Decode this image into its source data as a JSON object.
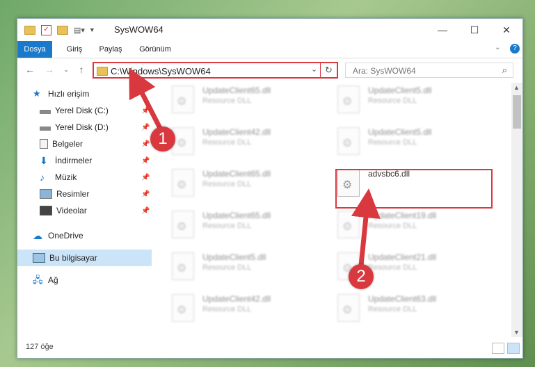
{
  "window": {
    "title": "SysWOW64"
  },
  "ribbon": {
    "tabs": [
      "Dosya",
      "Giriş",
      "Paylaş",
      "Görünüm"
    ]
  },
  "address": {
    "path": "C:\\Windows\\SysWOW64"
  },
  "search": {
    "placeholder": "Ara: SysWOW64"
  },
  "sidebar": {
    "items": [
      {
        "label": "Hızlı erişim"
      },
      {
        "label": "Yerel Disk (C:)"
      },
      {
        "label": "Yerel Disk (D:)"
      },
      {
        "label": "Belgeler"
      },
      {
        "label": "İndirmeler"
      },
      {
        "label": "Müzik"
      },
      {
        "label": "Resimler"
      },
      {
        "label": "Videolar"
      },
      {
        "label": "OneDrive"
      },
      {
        "label": "Bu bilgisayar"
      },
      {
        "label": "Ağ"
      }
    ]
  },
  "files": [
    {
      "name": "UpdateClient65.dll",
      "type": "Resource DLL"
    },
    {
      "name": "UpdateClient5.dll",
      "type": "Resource DLL"
    },
    {
      "name": "UpdateClient42.dll",
      "type": "Resource DLL"
    },
    {
      "name": "UpdateClient5.dll",
      "type": "Resource DLL"
    },
    {
      "name": "UpdateClient65.dll",
      "type": "Resource DLL"
    },
    {
      "name": "advsbc6.dll",
      "type": ""
    },
    {
      "name": "UpdateClient65.dll",
      "type": "Resource DLL"
    },
    {
      "name": "UpdateClient19.dll",
      "type": "Resource DLL"
    },
    {
      "name": "UpdateClient5.dll",
      "type": "Resource DLL"
    },
    {
      "name": "UpdateClient21.dll",
      "type": "Resource DLL"
    },
    {
      "name": "UpdateClient42.dll",
      "type": "Resource DLL"
    },
    {
      "name": "UpdateClient63.dll",
      "type": "Resource DLL"
    }
  ],
  "status": {
    "count": "127 öğe"
  },
  "annotations": {
    "step1": "1",
    "step2": "2"
  },
  "colors": {
    "accent": "#1979ca",
    "highlight": "#d9383f"
  }
}
